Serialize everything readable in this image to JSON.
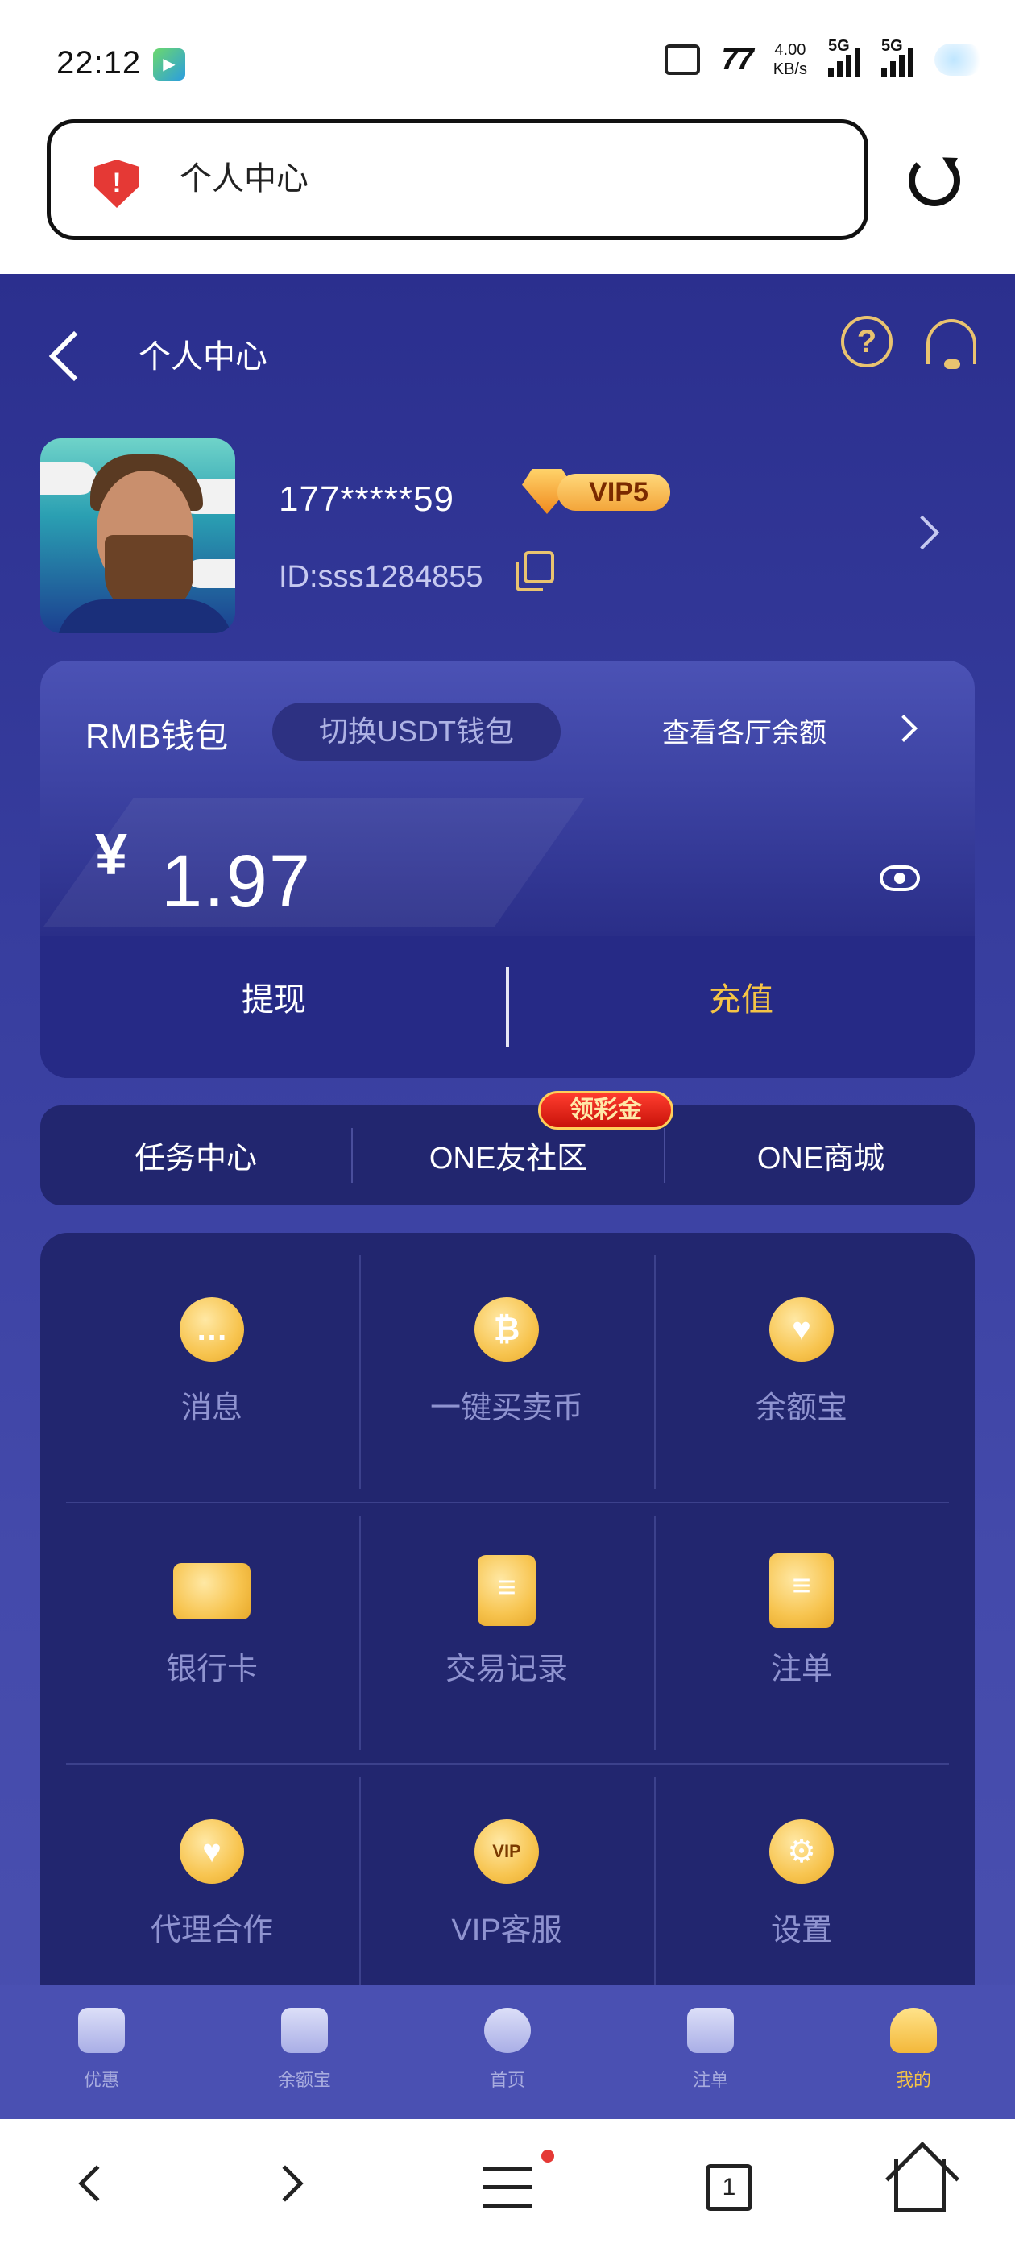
{
  "status_bar": {
    "time": "22:12",
    "net_speed_value": "4.00",
    "net_speed_unit": "KB/s",
    "sim1": "5G",
    "sim2": "5G"
  },
  "browser": {
    "page_title": "个人中心",
    "tab_count": "1"
  },
  "header": {
    "title": "个人中心"
  },
  "profile": {
    "phone": "177*****59",
    "vip_level": "VIP5",
    "user_id": "ID:sss1284855"
  },
  "wallet": {
    "label": "RMB钱包",
    "switch_label": "切换USDT钱包",
    "view_balance_link": "查看各厅余额",
    "currency_symbol": "¥",
    "amount": "1.97",
    "withdraw_label": "提现",
    "deposit_label": "充值"
  },
  "quick_links": [
    {
      "label": "任务中心"
    },
    {
      "label": "ONE友社区"
    },
    {
      "label": "ONE商城"
    }
  ],
  "quick_badge": "领彩金",
  "grid": [
    {
      "label": "消息",
      "icon": "message-icon"
    },
    {
      "label": "一键买卖币",
      "icon": "bitcoin-icon"
    },
    {
      "label": "余额宝",
      "icon": "handshake-icon"
    },
    {
      "label": "银行卡",
      "icon": "bank-card-icon"
    },
    {
      "label": "交易记录",
      "icon": "document-icon"
    },
    {
      "label": "注单",
      "icon": "receipt-icon"
    },
    {
      "label": "代理合作",
      "icon": "handshake-icon"
    },
    {
      "label": "VIP客服",
      "icon": "vip-support-icon"
    },
    {
      "label": "设置",
      "icon": "settings-icon"
    }
  ],
  "tabbar": [
    {
      "label": "优惠"
    },
    {
      "label": "余额宝"
    },
    {
      "label": "首页"
    },
    {
      "label": "注单"
    },
    {
      "label": "我的"
    }
  ],
  "colors": {
    "accent_gold": "#f5c445",
    "app_bg": "#2b2f8e",
    "card_bg": "#22266f",
    "alert_red": "#e53935"
  }
}
